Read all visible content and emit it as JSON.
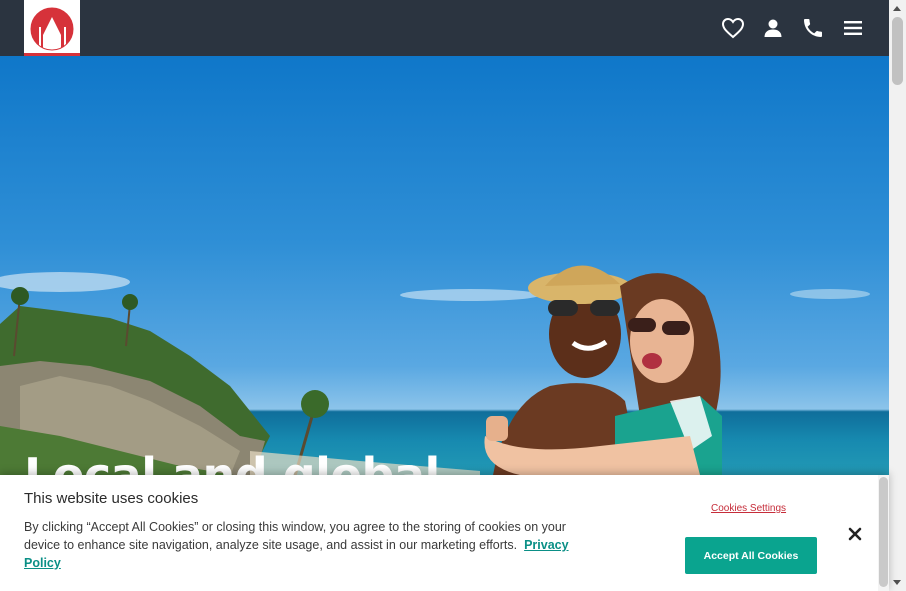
{
  "header": {
    "logo_icon": "mosque-skyline-logo",
    "icons": [
      "heart-icon",
      "user-icon",
      "phone-icon",
      "menu-icon"
    ]
  },
  "hero": {
    "title": "Local and global"
  },
  "cookie_banner": {
    "title": "This website uses cookies",
    "text": "By clicking “Accept All Cookies” or closing this window, you agree to the storing of cookies on your device to enhance site navigation, analyze site usage, and assist in our marketing efforts.",
    "privacy_link": "Privacy Policy",
    "settings_label": "Cookies Settings",
    "accept_label": "Accept All Cookies",
    "close_icon": "close-icon"
  },
  "colors": {
    "header_bg": "#2b3440",
    "brand_red": "#d6323a",
    "accept_green": "#0aa48f",
    "link_teal": "#0a8f86"
  }
}
